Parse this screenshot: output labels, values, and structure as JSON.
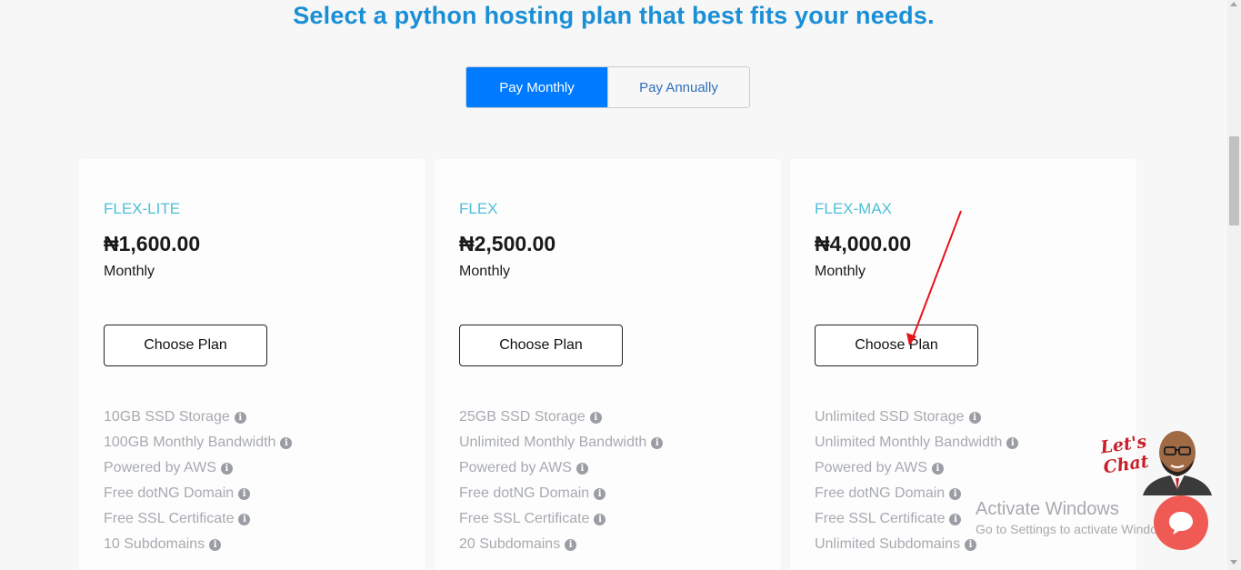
{
  "page": {
    "title": "Select a python hosting plan that best fits your needs."
  },
  "billing_toggle": {
    "monthly_label": "Pay Monthly",
    "annually_label": "Pay Annually",
    "selected": "Pay Monthly"
  },
  "plans": [
    {
      "name": "FLEX-LITE",
      "price": "₦1,600.00",
      "period": "Monthly",
      "button_label": "Choose Plan",
      "features": [
        "10GB SSD Storage",
        "100GB Monthly Bandwidth",
        "Powered by AWS",
        "Free dotNG Domain",
        "Free SSL Certificate",
        "10 Subdomains"
      ]
    },
    {
      "name": "FLEX",
      "price": "₦2,500.00",
      "period": "Monthly",
      "button_label": "Choose Plan",
      "features": [
        "25GB SSD Storage",
        "Unlimited Monthly Bandwidth",
        "Powered by AWS",
        "Free dotNG Domain",
        "Free SSL Certificate",
        "20 Subdomains"
      ]
    },
    {
      "name": "FLEX-MAX",
      "price": "₦4,000.00",
      "period": "Monthly",
      "button_label": "Choose Plan",
      "features": [
        "Unlimited SSD Storage",
        "Unlimited Monthly Bandwidth",
        "Powered by AWS",
        "Free dotNG Domain",
        "Free SSL Certificate",
        "Unlimited Subdomains"
      ]
    }
  ],
  "icons": {
    "feature_info": "info-circle-icon",
    "chat": "chat-bubble-icon"
  },
  "chat_widget": {
    "label": "Let's Chat"
  },
  "activate_windows": {
    "title": "Activate Windows",
    "subtitle": "Go to Settings to activate Windows."
  },
  "colors": {
    "title": "#1a8fd6",
    "toggle_active": "#007bff",
    "plan_name": "#4fbfd8",
    "feature_text": "#a7aab0",
    "chat_button": "#f05a54",
    "annotation_arrow": "#e8121c"
  }
}
